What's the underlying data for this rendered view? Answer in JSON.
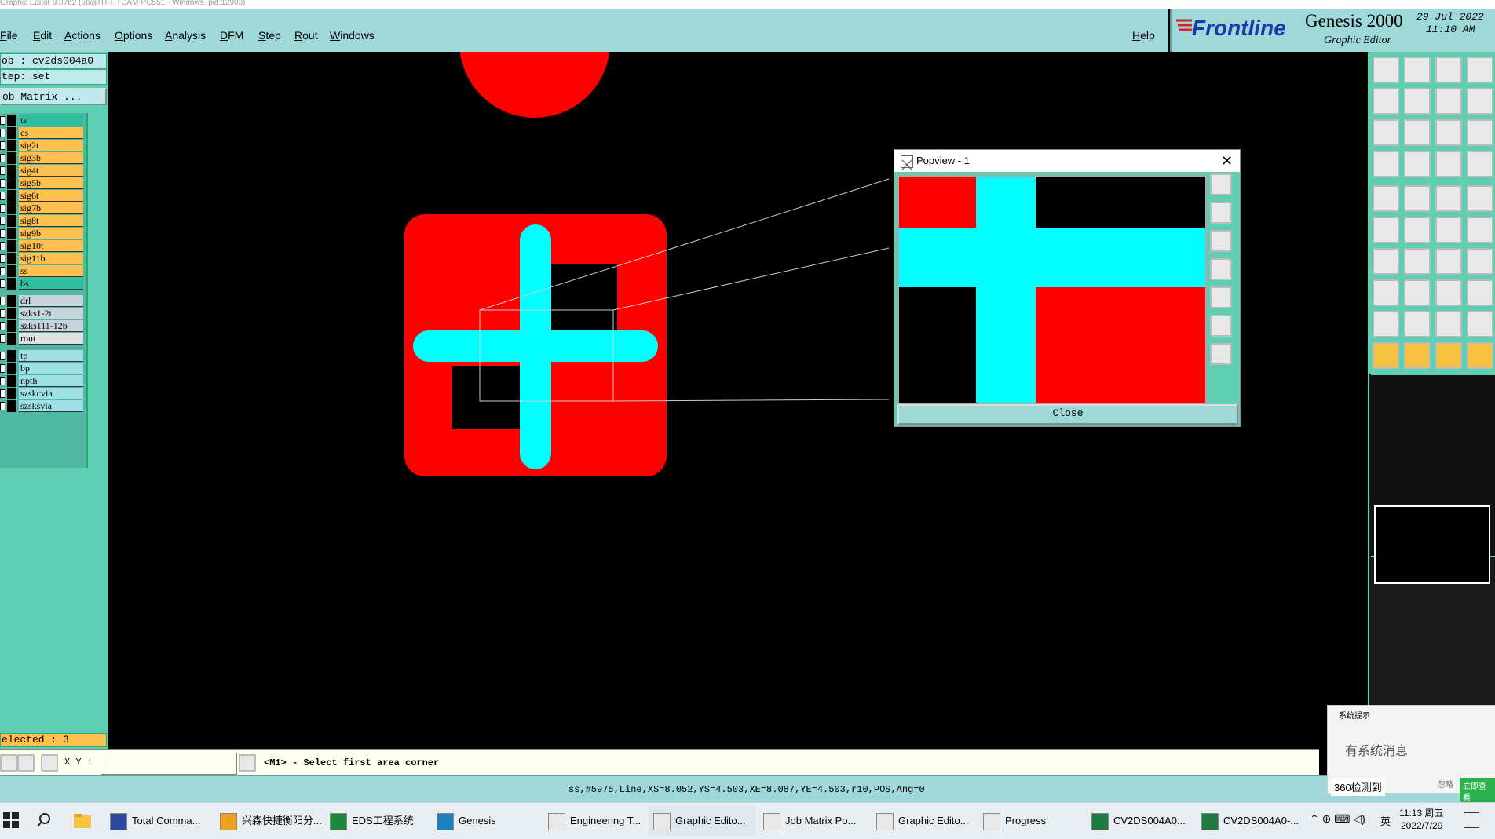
{
  "window": {
    "title": "Graphic Editor 9.07b2 (6b@HT-HTCAM-PC551 - Windows, pid:12908)"
  },
  "menu": [
    "File",
    "Edit",
    "Actions",
    "Options",
    "Analysis",
    "DFM",
    "Step",
    "Rout",
    "Windows"
  ],
  "help": "Help",
  "brand": {
    "logo": "Frontline",
    "product": "Genesis 2000",
    "subtitle": "Graphic Editor",
    "date": "29 Jul 2022",
    "time": "11:10 AM"
  },
  "job": {
    "job_line": "ob : cv2ds004a0",
    "step_line": "tep: set",
    "matrix_button": "ob Matrix ..."
  },
  "layers": [
    {
      "name": "ts",
      "color": "#2fbf9f"
    },
    {
      "name": "cs",
      "color": "#ffc04d"
    },
    {
      "name": "sig2t",
      "color": "#ffc04d"
    },
    {
      "name": "sig3b",
      "color": "#ffc04d"
    },
    {
      "name": "sig4t",
      "color": "#ffc04d"
    },
    {
      "name": "sig5b",
      "color": "#ffc04d"
    },
    {
      "name": "sig6t",
      "color": "#ffc04d"
    },
    {
      "name": "sig7b",
      "color": "#ffc04d"
    },
    {
      "name": "sig8t",
      "color": "#ffc04d"
    },
    {
      "name": "sig9b",
      "color": "#ffc04d"
    },
    {
      "name": "sig10t",
      "color": "#ffc04d"
    },
    {
      "name": "sig11b",
      "color": "#ffc04d"
    },
    {
      "name": "ss",
      "color": "#ffc04d"
    },
    {
      "name": "bs",
      "color": "#2fbf9f"
    },
    {
      "name": "drl",
      "color": "#c8d4dc"
    },
    {
      "name": "szks1-2t",
      "color": "#c8d4dc"
    },
    {
      "name": "szks111-12b",
      "color": "#c8d4dc"
    },
    {
      "name": "rout",
      "color": "#e0e0e0"
    },
    {
      "name": "tp",
      "color": "#9fe0e6"
    },
    {
      "name": "bp",
      "color": "#9fe0e6"
    },
    {
      "name": "npth",
      "color": "#9fe0e6"
    },
    {
      "name": "szskcvia",
      "color": "#9fe0e6"
    },
    {
      "name": "szsksvia",
      "color": "#9fe0e6"
    }
  ],
  "selected": "elected : 3",
  "popview": {
    "title": "Popview - 1",
    "close_button": "Close"
  },
  "cmd": {
    "xy_label": "X Y :",
    "xy_value": "",
    "prompt": "<M1> - Select first area corner"
  },
  "status": "ss,#5975,Line,XS=8.052,YS=4.503,XE=8.087,YE=4.503,r10,POS,Ang=0",
  "notification": {
    "header": "系统提示",
    "message": "有系统消息",
    "ignore": "忽略",
    "view": "立即查看",
    "security": "360检测到"
  },
  "taskbar": {
    "items": [
      "Total Comma...",
      "兴森快捷衡阳分...",
      "EDS工程系统",
      "Genesis",
      "Engineering T...",
      "Graphic Edito...",
      "Job Matrix Po...",
      "Graphic Edito...",
      "Progress",
      "CV2DS004A0...",
      "CV2DS004A0-..."
    ],
    "time": "11:13 周五",
    "date": "2022/7/29",
    "ime": "英"
  },
  "colors": {
    "pad_red": "#ff0000",
    "line_cyan": "#00ffff",
    "panel_teal": "#5fcfb3",
    "menu_bg": "#9fd8d8"
  }
}
